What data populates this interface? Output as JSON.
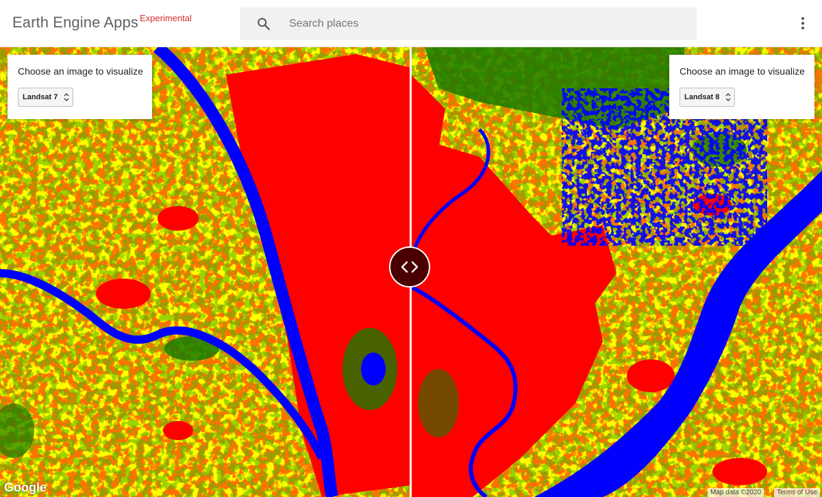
{
  "app": {
    "title": "Earth Engine Apps",
    "badge": "Experimental",
    "badge_color": "#d32f2f"
  },
  "search": {
    "placeholder": "Search places",
    "icon": "search-icon"
  },
  "header_menu": {
    "icon": "more-vert-icon"
  },
  "left_panel": {
    "label": "Choose an image to visualize",
    "selected": "Landsat 7"
  },
  "right_panel": {
    "label": "Choose an image to visualize",
    "selected": "Landsat 8"
  },
  "legend_colors": {
    "cropland": "#ffff00",
    "urban": "#ff0000",
    "water": "#0000ff",
    "vegetation": "#1a7a00"
  },
  "slider": {
    "icon": "swipe-handle-icon"
  },
  "footer": {
    "logo": "Google",
    "map_data": "Map data ©2020",
    "terms": "Terms of Use"
  }
}
